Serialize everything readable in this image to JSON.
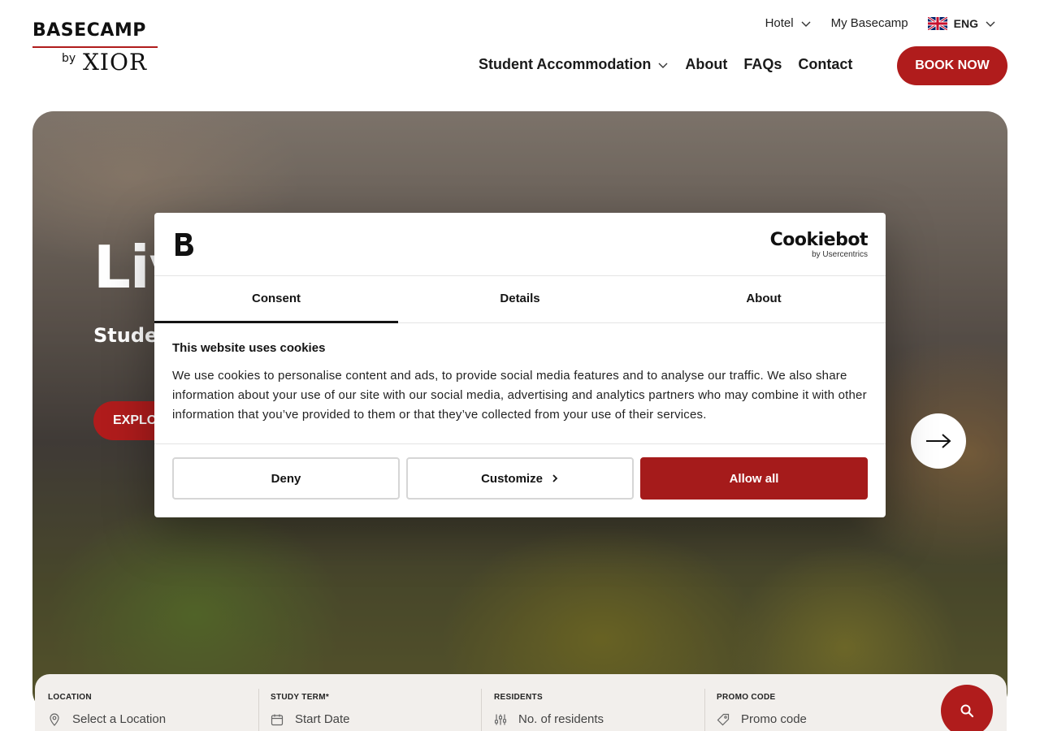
{
  "header": {
    "logo": {
      "brand": "BASECAMP",
      "by": "by",
      "partner": "XIOR"
    },
    "top_links": [
      {
        "label": "Hotel",
        "has_dropdown": true
      },
      {
        "label": "My Basecamp",
        "has_dropdown": false
      }
    ],
    "language": {
      "label": "ENG",
      "flag": "uk-flag-icon"
    },
    "nav": [
      {
        "label": "Student Accommodation",
        "has_dropdown": true
      },
      {
        "label": "About"
      },
      {
        "label": "FAQs"
      },
      {
        "label": "Contact"
      }
    ],
    "book_now": "BOOK NOW"
  },
  "hero": {
    "title_visible": "Liv",
    "subtitle_visible": "Studen",
    "explore_visible": "EXPLO"
  },
  "search": {
    "location": {
      "label": "LOCATION",
      "placeholder": "Select a Location",
      "icon": "map-pin-icon"
    },
    "study_term": {
      "label": "STUDY TERM*",
      "placeholder": "Start Date",
      "icon": "calendar-icon"
    },
    "residents": {
      "label": "RESIDENTS",
      "placeholder": "No. of residents",
      "icon": "sliders-icon"
    },
    "promo": {
      "label": "PROMO CODE",
      "placeholder": "Promo code",
      "icon": "tag-icon"
    }
  },
  "cookie_dialog": {
    "brand_name": "Cookiebot",
    "brand_by": "by Usercentrics",
    "tabs": [
      "Consent",
      "Details",
      "About"
    ],
    "active_tab": "Consent",
    "heading": "This website uses cookies",
    "body": "We use cookies to personalise content and ads, to provide social media features and to analyse our traffic. We also share information about your use of our site with our social media, advertising and analytics partners who may combine it with other information that you’ve provided to them or that they’ve collected from your use of their services.",
    "buttons": {
      "deny": "Deny",
      "customize": "Customize",
      "allow": "Allow all"
    }
  },
  "colors": {
    "brand_red": "#b01c1c",
    "cookie_red": "#a51b1b",
    "search_bg": "#f2efec"
  }
}
